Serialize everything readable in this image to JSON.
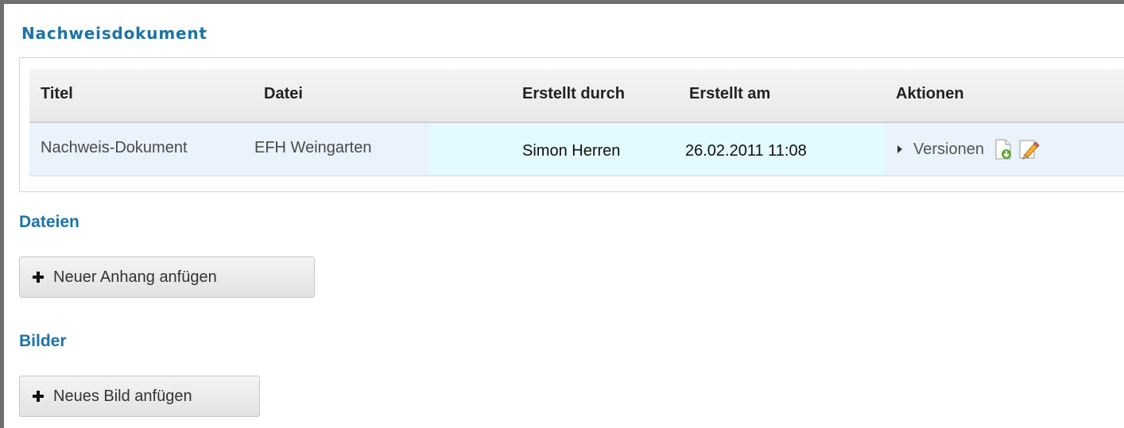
{
  "sections": {
    "nachweis_title": "Nachweisdokument",
    "dateien_title": "Dateien",
    "bilder_title": "Bilder"
  },
  "table": {
    "headers": [
      "Titel",
      "Datei",
      "Erstellt durch",
      "Erstellt am",
      "Aktionen"
    ],
    "rows": [
      {
        "titel": "Nachweis-Dokument",
        "datei": "EFH Weingarten",
        "erstellt_durch": "Simon Herren",
        "erstellt_am": "26.02.2011  11:08",
        "actions": {
          "versions_label": "Versionen",
          "download_icon": "document-download-icon",
          "edit_icon": "pencil-edit-icon"
        }
      }
    ]
  },
  "buttons": {
    "add_attachment": "Neuer Anhang anfügen",
    "add_image": "Neues Bild anfügen"
  },
  "colors": {
    "section_title": "#1d72a8",
    "row_background": "#eaf3fb",
    "row_highlight": "#e3fafe"
  }
}
